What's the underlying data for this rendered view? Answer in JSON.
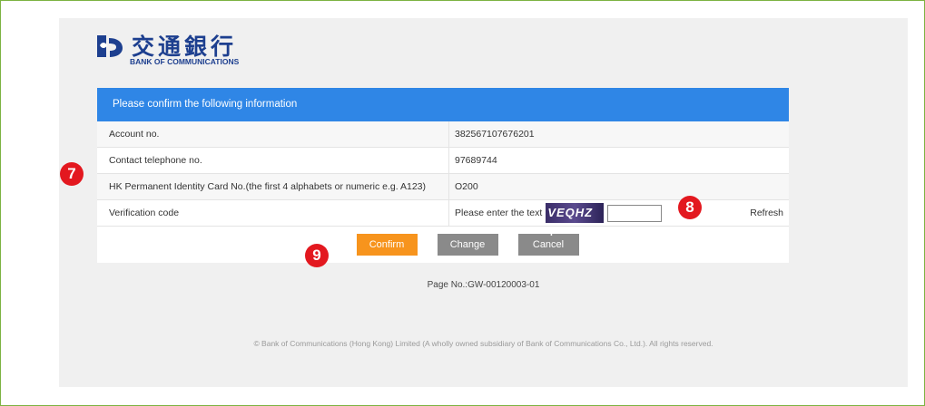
{
  "brand": {
    "name_cn": "交通銀行",
    "name_en": "BANK OF COMMUNICATIONS"
  },
  "panel": {
    "header": "Please confirm the following information",
    "rows": [
      {
        "label": "Account no.",
        "value": "382567107676201"
      },
      {
        "label": "Contact telephone no.",
        "value": "97689744"
      },
      {
        "label": "HK Permanent Identity Card No.(the first 4 alphabets or numeric e.g. A123)",
        "value": "O200"
      }
    ],
    "verification": {
      "label": "Verification code",
      "prompt": "Please enter the text",
      "captcha_text": "VEQHZ +",
      "input_value": "",
      "refresh_label": "Refresh"
    }
  },
  "buttons": {
    "confirm": "Confirm",
    "change": "Change",
    "cancel": "Cancel"
  },
  "page_no": "Page No.:GW-00120003-01",
  "footer": "© Bank of Communications (Hong Kong) Limited (A wholly owned subsidiary of Bank of Communications Co., Ltd.). All rights reserved.",
  "annotations": {
    "badge_7": "7",
    "badge_8": "8",
    "badge_9": "9"
  },
  "colors": {
    "header_blue": "#2f86e6",
    "confirm_orange": "#f7941d",
    "badge_red": "#e3181f",
    "brand_navy": "#1d3f8f"
  }
}
